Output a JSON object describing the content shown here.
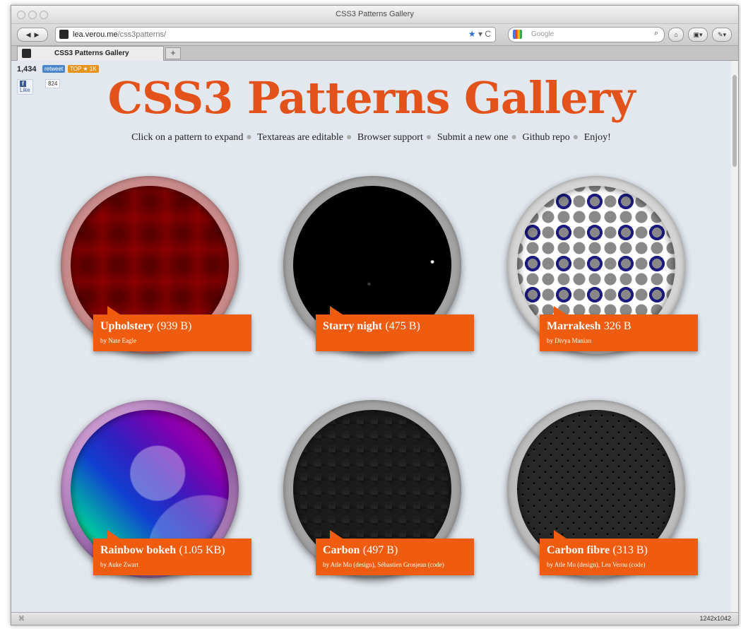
{
  "window": {
    "title": "CSS3 Patterns Gallery"
  },
  "toolbar": {
    "url_domain": "lea.verou.me",
    "url_path": "/css3patterns/",
    "search_placeholder": "Google",
    "back_icon": "back-arrow-icon",
    "forward_icon": "forward-arrow-icon"
  },
  "tabs": [
    {
      "label": "CSS3 Patterns Gallery"
    }
  ],
  "share": {
    "tweet_count": "1,434",
    "retweet": "retweet",
    "top_badge": "TOP ★ 1K",
    "like": "Like",
    "like_count": "824"
  },
  "page": {
    "title": "CSS3 Patterns Gallery",
    "nav": [
      "Click on a pattern to expand",
      "Textareas are editable",
      "Browser support",
      "Submit a new one",
      "Github repo",
      "Enjoy!"
    ]
  },
  "patterns": [
    {
      "name": "Upholstery",
      "size": "(939 B)",
      "by": "by Nate Eagle"
    },
    {
      "name": "Starry night",
      "size": "(475 B)",
      "by": ""
    },
    {
      "name": "Marrakesh",
      "size": "326 B",
      "by": "by Divya Manian"
    },
    {
      "name": "Rainbow bokeh",
      "size": "(1.05 KB)",
      "by": "by Auke Zwart"
    },
    {
      "name": "Carbon",
      "size": "(497 B)",
      "by": "by Atle Mo (design), Sébastien Grosjean (code)"
    },
    {
      "name": "Carbon fibre",
      "size": "(313 B)",
      "by": "by Atle Mo (design), Lea Verou (code)"
    }
  ],
  "status": {
    "left": "⌘",
    "right": "1242x1042"
  },
  "colors": {
    "accent": "#e3521a",
    "label_bg": "#f05c0f"
  }
}
